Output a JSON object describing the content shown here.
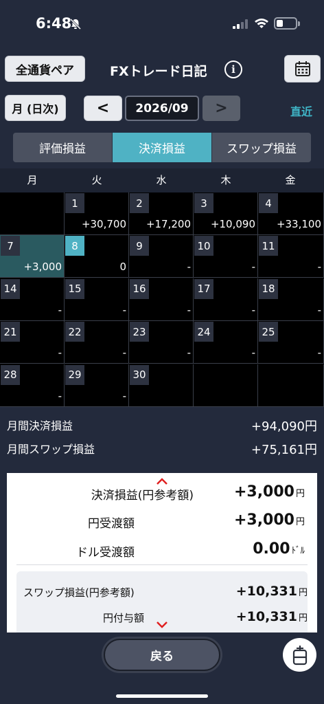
{
  "status": {
    "time": "6:48"
  },
  "header": {
    "currency_label": "全通貨ペア",
    "title": "FXトレード日記",
    "info_label": "i"
  },
  "nav": {
    "period_label": "月 (日次)",
    "prev_label": "<",
    "next_label": ">",
    "date": "2026/09",
    "latest_label": "直近"
  },
  "segments": [
    {
      "label": "評価損益",
      "active": false
    },
    {
      "label": "決済損益",
      "active": true
    },
    {
      "label": "スワップ損益",
      "active": false
    }
  ],
  "calendar": {
    "weekdays": [
      "月",
      "火",
      "水",
      "木",
      "金"
    ],
    "weeks": [
      [
        null,
        {
          "day": "1",
          "value": "+30,700"
        },
        {
          "day": "2",
          "value": "+17,200"
        },
        {
          "day": "3",
          "value": "+10,090"
        },
        {
          "day": "4",
          "value": "+33,100"
        }
      ],
      [
        {
          "day": "7",
          "value": "+3,000",
          "selected": true
        },
        {
          "day": "8",
          "value": "0",
          "today": true
        },
        {
          "day": "9",
          "value": "-"
        },
        {
          "day": "10",
          "value": "-"
        },
        {
          "day": "11",
          "value": "-"
        }
      ],
      [
        {
          "day": "14",
          "value": "-"
        },
        {
          "day": "15",
          "value": "-"
        },
        {
          "day": "16",
          "value": "-"
        },
        {
          "day": "17",
          "value": "-"
        },
        {
          "day": "18",
          "value": "-"
        }
      ],
      [
        {
          "day": "21",
          "value": "-"
        },
        {
          "day": "22",
          "value": "-"
        },
        {
          "day": "23",
          "value": "-"
        },
        {
          "day": "24",
          "value": "-"
        },
        {
          "day": "25",
          "value": "-"
        }
      ],
      [
        {
          "day": "28",
          "value": "-"
        },
        {
          "day": "29",
          "value": "-"
        },
        {
          "day": "30",
          "value": ""
        },
        null,
        null
      ]
    ]
  },
  "summary": {
    "settle_label": "月間決済損益",
    "settle_value": "+94,090円",
    "swap_label": "月間スワップ損益",
    "swap_value": "+75,161円"
  },
  "detail": {
    "settle_ref_label": "決済損益(円参考額)",
    "settle_ref_value": "+3,000",
    "settle_ref_unit": "円",
    "yen_label": "円受渡額",
    "yen_value": "+3,000",
    "yen_unit": "円",
    "usd_label": "ドル受渡額",
    "usd_value": "0.00",
    "usd_unit": "ﾄﾞﾙ",
    "swap_ref_label": "スワップ損益(円参考額)",
    "swap_ref_value": "+10,331",
    "swap_ref_unit": "円",
    "swap_grant_label": "円付与額",
    "swap_grant_value": "+10,331",
    "swap_grant_unit": "円"
  },
  "footer": {
    "back_label": "戻る",
    "fab_label": "卣"
  },
  "colors": {
    "accent": "#4fb2c4",
    "chevron": "#e02020",
    "background": "#232a3c"
  }
}
